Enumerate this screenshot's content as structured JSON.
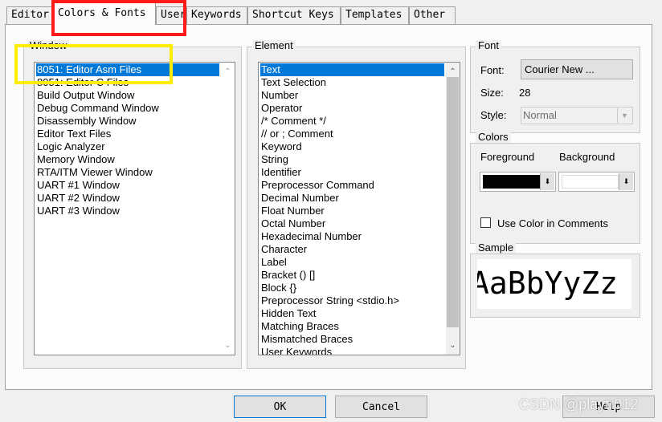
{
  "tabs": [
    {
      "label": "Editor"
    },
    {
      "label": "Colors & Fonts"
    },
    {
      "label": "User"
    },
    {
      "label": "Keywords"
    },
    {
      "label": "Shortcut Keys"
    },
    {
      "label": "Templates"
    },
    {
      "label": "Other"
    }
  ],
  "window_group": {
    "label": "Window",
    "items": [
      "8051: Editor Asm Files",
      "8051: Editor C Files",
      "Build Output Window",
      "Debug Command Window",
      "Disassembly Window",
      "Editor Text Files",
      "Logic Analyzer",
      "Memory Window",
      "RTA/ITM Viewer Window",
      "UART #1 Window",
      "UART #2 Window",
      "UART #3 Window"
    ],
    "selected_index": 0
  },
  "element_group": {
    "label": "Element",
    "items": [
      "Text",
      "Text Selection",
      "Number",
      "Operator",
      "/* Comment */",
      "// or ; Comment",
      "Keyword",
      "String",
      "Identifier",
      "Preprocessor Command",
      "Decimal Number",
      "Float Number",
      "Octal Number",
      "Hexadecimal Number",
      "Character",
      "Label",
      "Bracket () []",
      "Block {}",
      "Preprocessor String <stdio.h>",
      "Hidden Text",
      "Matching Braces",
      "Mismatched Braces",
      "User Keywords"
    ],
    "selected_index": 0
  },
  "font_group": {
    "label": "Font",
    "font_label": "Font:",
    "font_button": "Courier New ...",
    "size_label": "Size:",
    "size_value": "28",
    "style_label": "Style:",
    "style_value": "Normal"
  },
  "colors_group": {
    "label": "Colors",
    "foreground_label": "Foreground",
    "background_label": "Background",
    "foreground_color": "#000000",
    "background_color": "#ffffff",
    "use_color_comments_label": "Use Color in Comments",
    "use_color_comments_checked": false
  },
  "sample_group": {
    "label": "Sample",
    "sample_text": "AaBbYyZz"
  },
  "buttons": {
    "ok": "OK",
    "cancel": "Cancel",
    "help": "Help"
  },
  "watermark": "CSDN @playtr012",
  "highlight_colors": {
    "red": "#ff1a1a",
    "yellow": "#ffee00"
  }
}
